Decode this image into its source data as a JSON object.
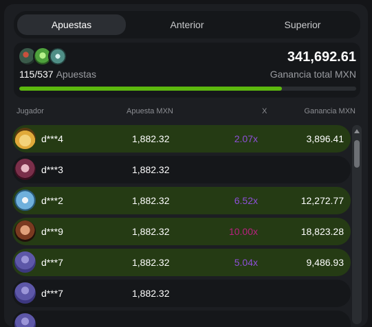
{
  "tabs": [
    {
      "label": "Apuestas",
      "active": true
    },
    {
      "label": "Anterior",
      "active": false
    },
    {
      "label": "Superior",
      "active": false
    }
  ],
  "summary": {
    "bets_count": "115/537",
    "bets_label": "Apuestas",
    "total_amount": "341,692.61",
    "total_label": "Ganancia total MXN",
    "progress_fraction": 0.78,
    "avatar_icons": [
      "avatar-icon-1",
      "avatar-icon-2",
      "avatar-icon-3"
    ]
  },
  "columns": {
    "player": "Jugador",
    "bet": "Apuesta MXN",
    "multiplier": "X",
    "win": "Ganancia MXN"
  },
  "rows": [
    {
      "player": "d***4",
      "bet": "1,882.32",
      "multiplier": "2.07x",
      "win": "3,896.41",
      "won": true,
      "mult_color": "#8e4fd8",
      "avatar": "monopoly-man-avatar"
    },
    {
      "player": "d***3",
      "bet": "1,882.32",
      "multiplier": "",
      "win": "",
      "won": false,
      "mult_color": "#8e4fd8",
      "avatar": "woman-avatar"
    },
    {
      "player": "d***2",
      "bet": "1,882.32",
      "multiplier": "6.52x",
      "win": "12,272.77",
      "won": true,
      "mult_color": "#8e4fd8",
      "avatar": "rocket-avatar"
    },
    {
      "player": "d***9",
      "bet": "1,882.32",
      "multiplier": "10.00x",
      "win": "18,823.28",
      "won": true,
      "mult_color": "#b8217f",
      "avatar": "bald-man-avatar"
    },
    {
      "player": "d***7",
      "bet": "1,882.32",
      "multiplier": "5.04x",
      "win": "9,486.93",
      "won": true,
      "mult_color": "#8e4fd8",
      "avatar": "default-user-avatar"
    },
    {
      "player": "d***7",
      "bet": "1,882.32",
      "multiplier": "",
      "win": "",
      "won": false,
      "mult_color": "#8e4fd8",
      "avatar": "default-user-avatar"
    },
    {
      "player": "",
      "bet": "",
      "multiplier": "",
      "win": "",
      "won": false,
      "mult_color": "#8e4fd8",
      "avatar": "default-user-avatar"
    }
  ]
}
